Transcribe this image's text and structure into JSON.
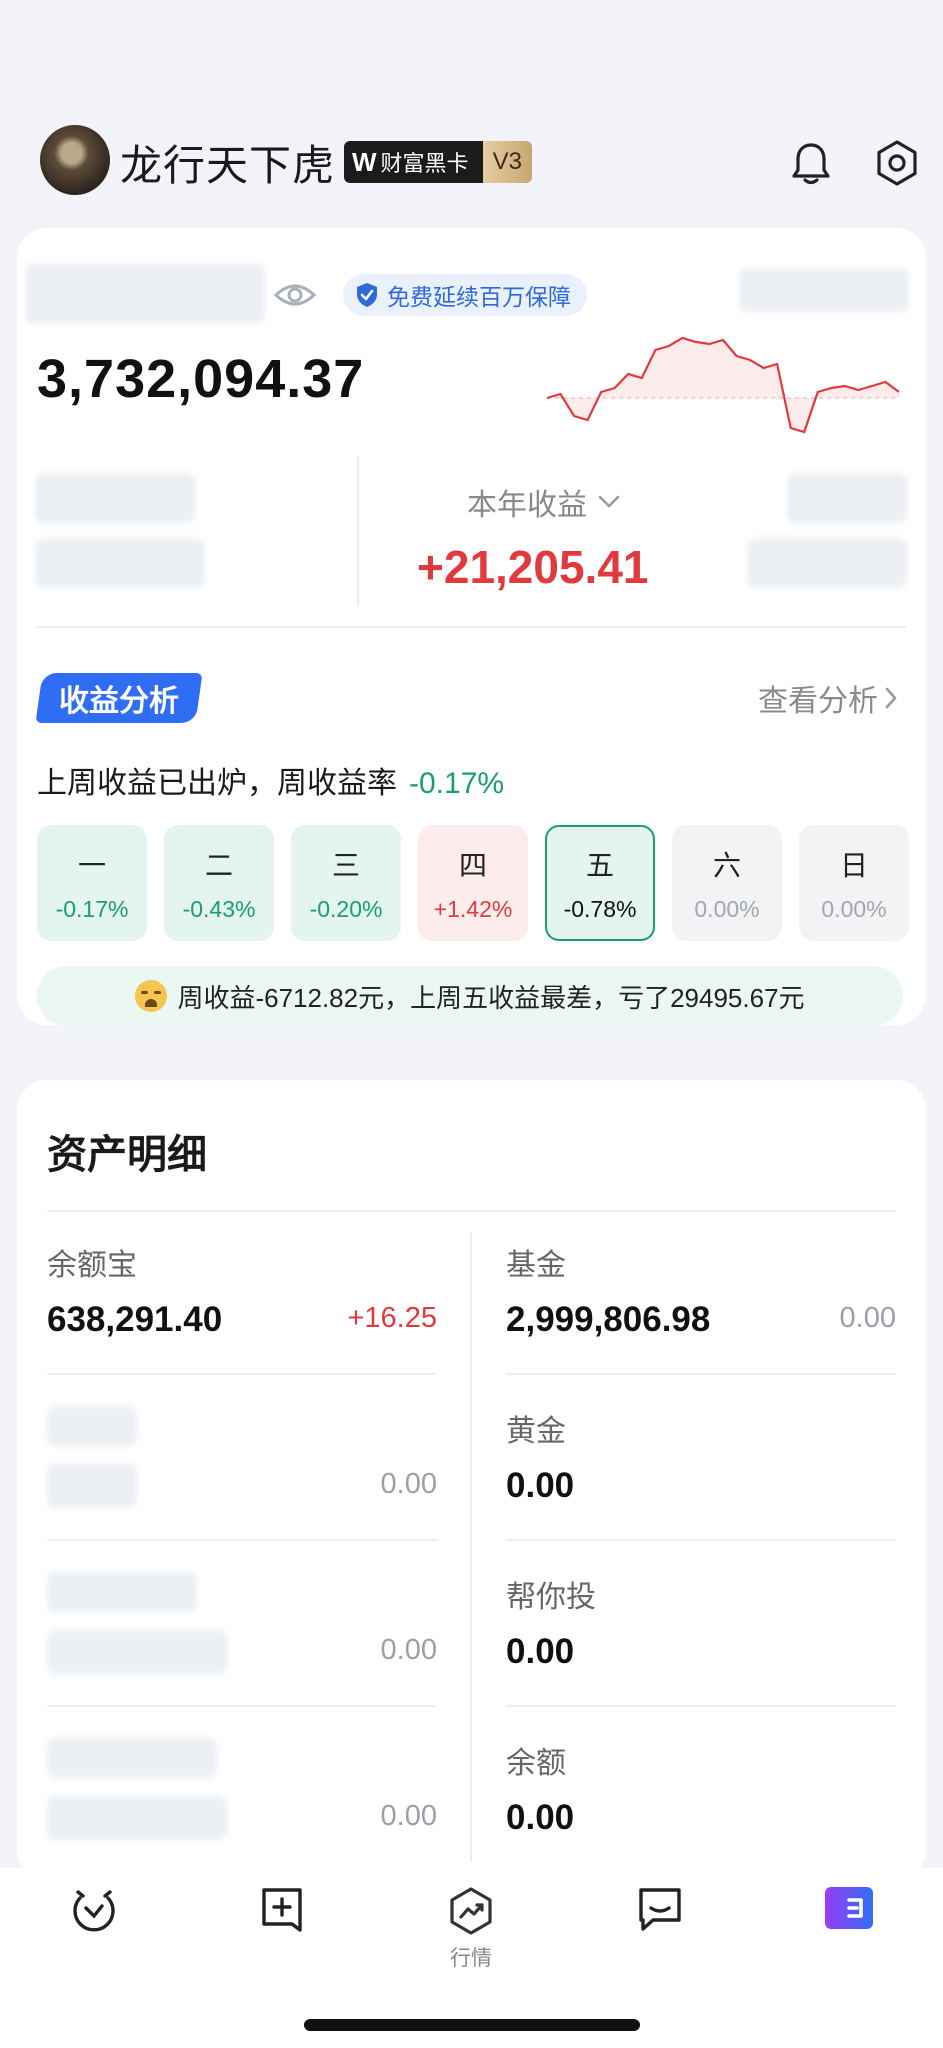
{
  "header": {
    "username": "龙行天下虎",
    "badge_logo": "W",
    "badge_text": "财富黑卡",
    "badge_level": "V3",
    "icons": [
      "avatar",
      "bell-icon",
      "settings-icon"
    ]
  },
  "overview": {
    "guarantee_text": "免费延续百万保障",
    "total_assets": "3,732,094.37",
    "year_label": "本年收益",
    "year_value": "+21,205.41",
    "sparkline_trend": [
      0.0,
      -0.3,
      0.1,
      0.4,
      0.8,
      1.0,
      0.9,
      0.7,
      0.5,
      -0.5,
      0.1,
      0.2,
      0.2,
      0.1
    ]
  },
  "analysis": {
    "tag": "收益分析",
    "view_link": "查看分析",
    "weekly_text": "上周收益已出炉，周收益率",
    "weekly_rate": "-0.17%",
    "days": [
      {
        "name": "一",
        "value": "-0.17%",
        "tone": "green"
      },
      {
        "name": "二",
        "value": "-0.43%",
        "tone": "green"
      },
      {
        "name": "三",
        "value": "-0.20%",
        "tone": "green"
      },
      {
        "name": "四",
        "value": "+1.42%",
        "tone": "red"
      },
      {
        "name": "五",
        "value": "-0.78%",
        "tone": "selected"
      },
      {
        "name": "六",
        "value": "0.00%",
        "tone": "grey"
      },
      {
        "name": "日",
        "value": "0.00%",
        "tone": "grey"
      }
    ],
    "summary": "周收益-6712.82元，上周五收益最差，亏了29495.67元"
  },
  "details": {
    "title": "资产明细",
    "left": [
      {
        "label": "余额宝",
        "value": "638,291.40",
        "change": "+16.25",
        "tone": "red"
      },
      {
        "label": "",
        "value": "",
        "change": "0.00",
        "tone": "grey"
      },
      {
        "label": "",
        "value": "",
        "change": "0.00",
        "tone": "grey"
      },
      {
        "label": "",
        "value": "",
        "change": "0.00",
        "tone": "grey"
      }
    ],
    "right": [
      {
        "label": "基金",
        "value": "2,999,806.98",
        "change": "0.00",
        "tone": "grey"
      },
      {
        "label": "黄金",
        "value": "0.00",
        "change": "",
        "tone": "grey"
      },
      {
        "label": "帮你投",
        "value": "0.00",
        "change": "",
        "tone": "grey"
      },
      {
        "label": "余额",
        "value": "0.00",
        "change": "",
        "tone": "grey"
      }
    ]
  },
  "tabbar": {
    "market_label": "行情",
    "icons": [
      "alarm-icon",
      "plus-note-icon",
      "market-icon",
      "message-icon",
      "wallet-icon"
    ]
  },
  "colors": {
    "accent_blue": "#2f6ef4",
    "gain_red": "#e03a3e",
    "loss_green": "#1a9e6e"
  }
}
